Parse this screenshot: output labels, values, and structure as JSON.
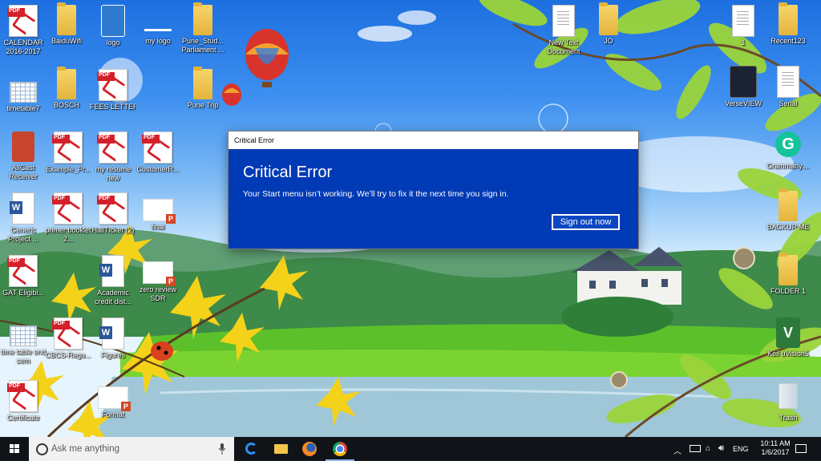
{
  "desktop": {
    "icons": [
      {
        "label": "CALENDAR 2016-2017",
        "kind": "pdf"
      },
      {
        "label": "BaiduWifi",
        "kind": "folder"
      },
      {
        "label": "logo",
        "kind": "app"
      },
      {
        "label": "my logo",
        "kind": "blank"
      },
      {
        "label": "Pune_Stud... Parliament ...",
        "kind": "folder"
      },
      {
        "label": "timetable7",
        "kind": "sheet"
      },
      {
        "label": "BOSCH",
        "kind": "folder"
      },
      {
        "label": "FEES LETTER",
        "kind": "pdf"
      },
      {
        "label": "Pune Trip",
        "kind": "folder"
      },
      {
        "label": "AllCast Receiver",
        "kind": "app"
      },
      {
        "label": "Example_Pr...",
        "kind": "pdf"
      },
      {
        "label": "my resume new",
        "kind": "pdf"
      },
      {
        "label": "CustomerR...",
        "kind": "pdf"
      },
      {
        "label": "Generic Project ...",
        "kind": "word"
      },
      {
        "label": "primer booklet 2...",
        "kind": "pdf"
      },
      {
        "label": "HallTicket (2)",
        "kind": "pdf"
      },
      {
        "label": "final",
        "kind": "ppt"
      },
      {
        "label": "GAT Eligibi...",
        "kind": "pdf"
      },
      {
        "label": "Academic credit dist...",
        "kind": "word"
      },
      {
        "label": "zero review SDR",
        "kind": "ppt"
      },
      {
        "label": "time table end sem",
        "kind": "sheet"
      },
      {
        "label": "CBCS-Regu...",
        "kind": "pdf"
      },
      {
        "label": "Figures",
        "kind": "word"
      },
      {
        "label": "Certificate",
        "kind": "pdf"
      },
      {
        "label": "Format",
        "kind": "ppt"
      },
      {
        "label": "New Text Document",
        "kind": "doc"
      },
      {
        "label": "JO",
        "kind": "folder"
      },
      {
        "label": "1",
        "kind": "doc"
      },
      {
        "label": "Recent123",
        "kind": "folder"
      },
      {
        "label": "VerseVIEW",
        "kind": "app"
      },
      {
        "label": "Serial",
        "kind": "doc"
      },
      {
        "label": "Grammarly....",
        "kind": "app"
      },
      {
        "label": "BACKUP ME",
        "kind": "folder"
      },
      {
        "label": "FOLDER 1",
        "kind": "folder"
      },
      {
        "label": "Keil uVision5",
        "kind": "app"
      },
      {
        "label": "Trash",
        "kind": "app"
      }
    ]
  },
  "dialog": {
    "window_title": "Critical Error",
    "heading": "Critical Error",
    "message": "Your Start menu isn’t working. We’ll try to fix it the next time you sign in.",
    "button_label": "Sign out now",
    "bg_color": "#003ab5"
  },
  "taskbar": {
    "search_placeholder": "Ask me anything",
    "apps": [
      "edge-icon",
      "file-explorer-icon",
      "firefox-icon",
      "chrome-icon"
    ],
    "language": "ENG",
    "time": "10:11 AM",
    "date": "1/6/2017"
  }
}
